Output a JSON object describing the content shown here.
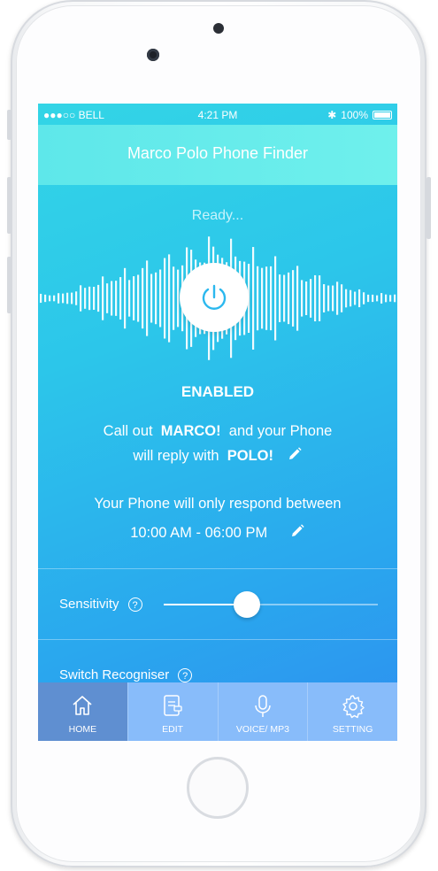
{
  "status_bar": {
    "carrier": "●●●○○ BELL",
    "time": "4:21 PM",
    "battery": "100%"
  },
  "app": {
    "title": "Marco Polo Phone Finder"
  },
  "main": {
    "status_text": "Ready...",
    "state_label": "ENABLED",
    "callout_prefix": "Call out",
    "callout_word": "MARCO!",
    "callout_suffix": "and your Phone",
    "reply_prefix": "will reply with",
    "reply_word": "POLO!",
    "respond_text": "Your Phone will only respond between",
    "time_range": "10:00 AM - 06:00 PM"
  },
  "settings": {
    "sensitivity_label": "Sensitivity",
    "sensitivity_value": 0.39,
    "switch_label": "Switch Recogniser",
    "help_glyph": "?"
  },
  "tabs": [
    {
      "label": "HOME",
      "icon": "home-icon",
      "active": true
    },
    {
      "label": "EDIT",
      "icon": "edit-icon",
      "active": false
    },
    {
      "label": "VOICE/ MP3",
      "icon": "microphone-icon",
      "active": false
    },
    {
      "label": "SETTING",
      "icon": "gear-icon",
      "active": false
    }
  ],
  "colors": {
    "accent": "#2aa6ee",
    "nav": "#6ff0ec",
    "tab_active": "#5f8fd1",
    "tab_bar": "#88bcfa"
  }
}
